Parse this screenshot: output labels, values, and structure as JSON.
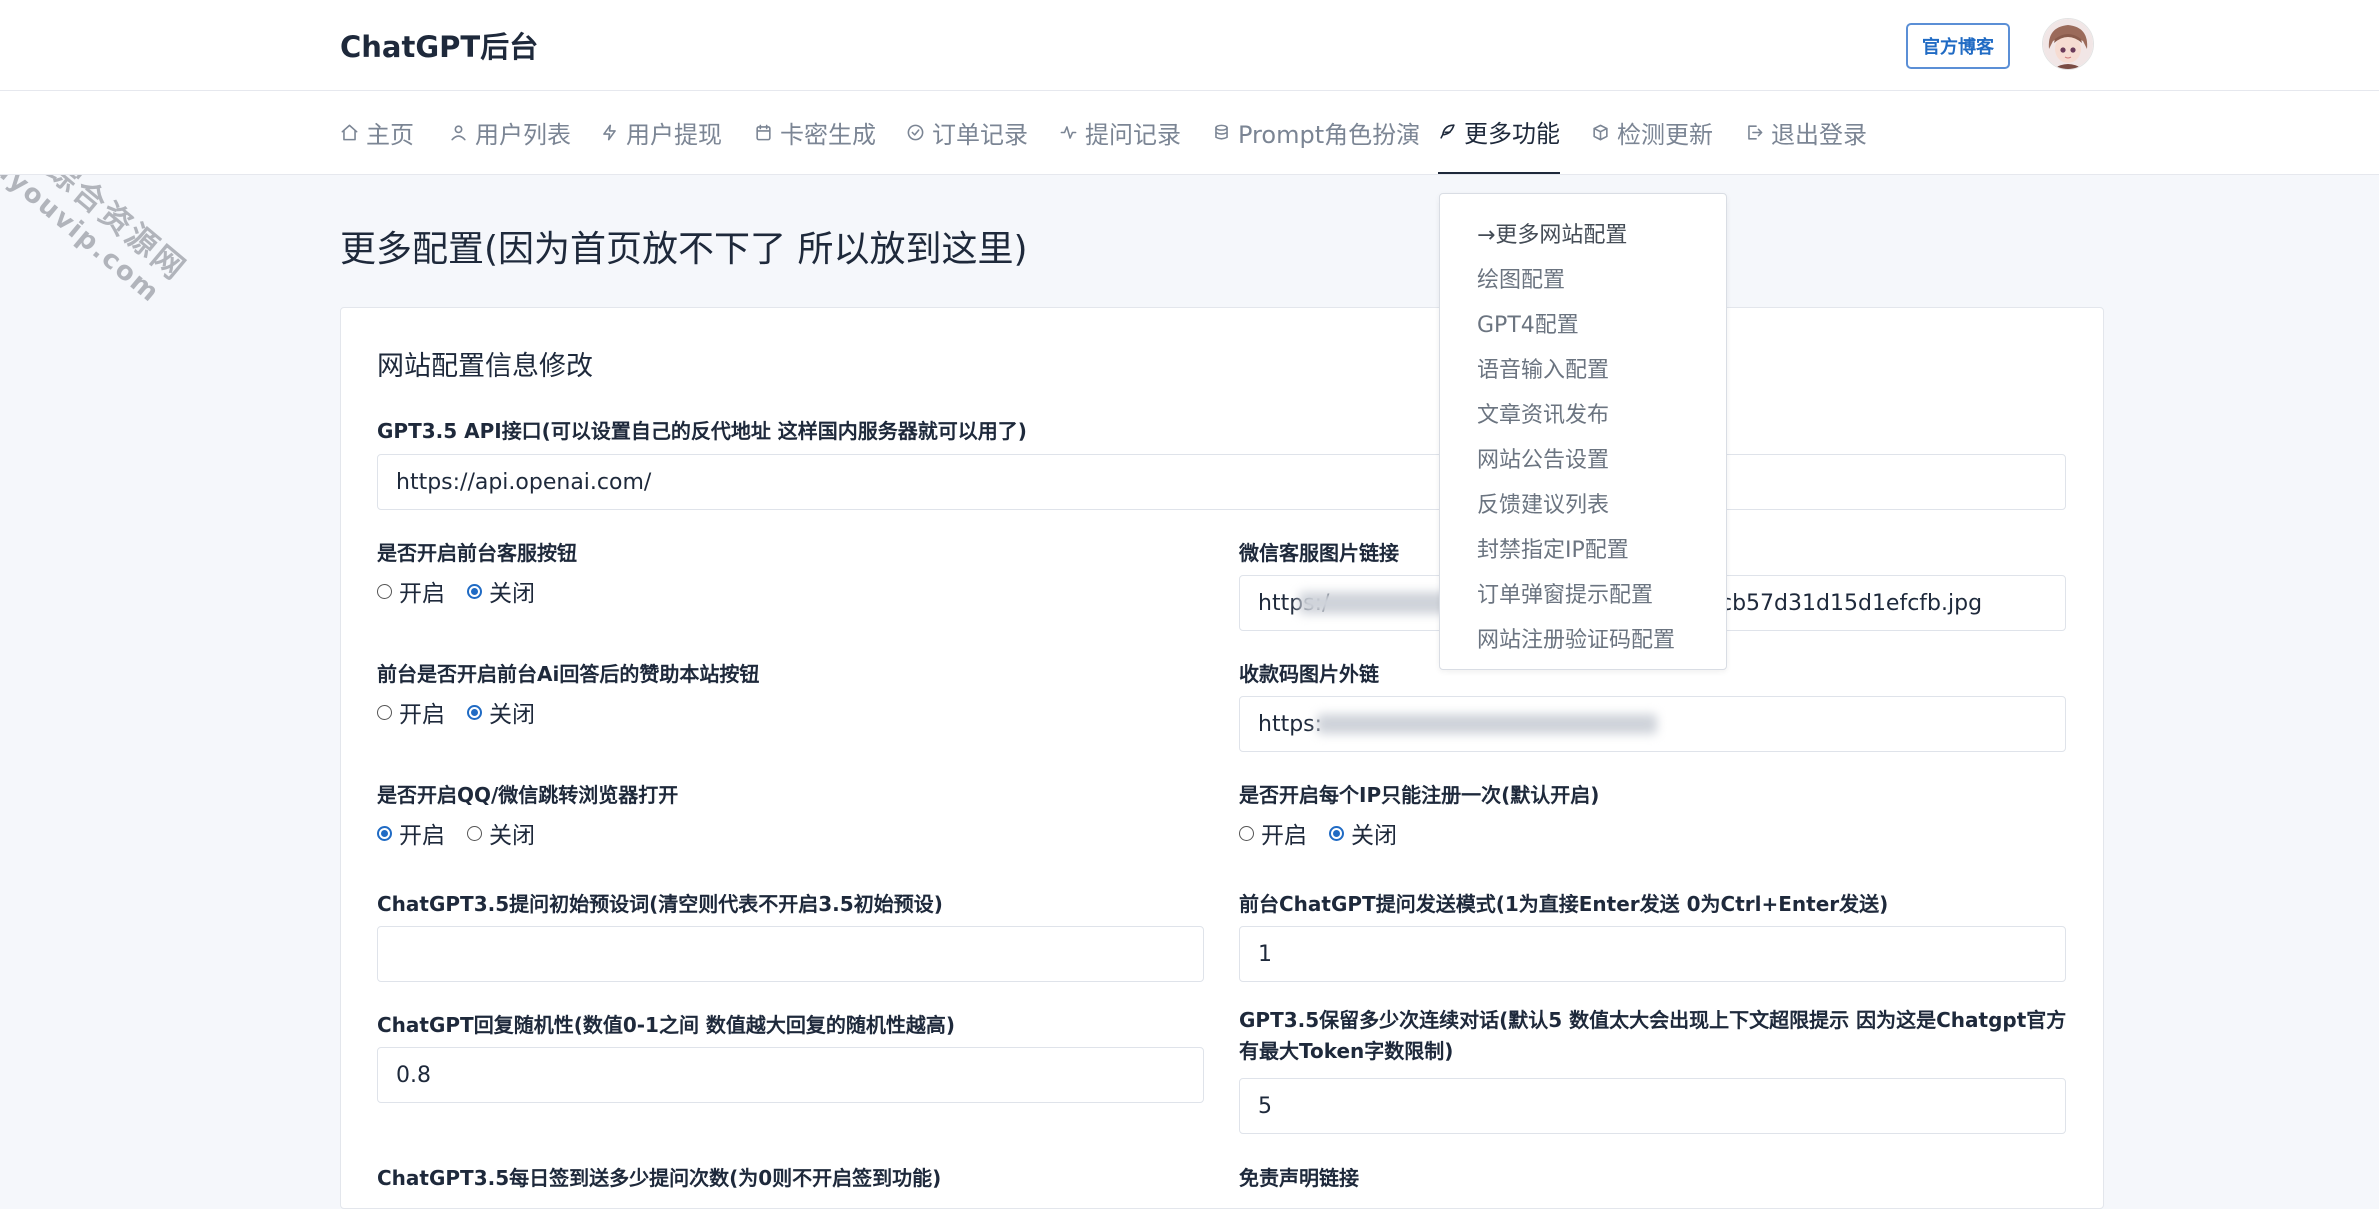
{
  "app": {
    "brand": "ChatGPT后台"
  },
  "header": {
    "blog_button": "官方博客"
  },
  "nav": {
    "items": [
      {
        "label": "主页",
        "icon": "home-icon"
      },
      {
        "label": "用户列表",
        "icon": "user-icon"
      },
      {
        "label": "用户提现",
        "icon": "bolt-icon"
      },
      {
        "label": "卡密生成",
        "icon": "calendar-icon"
      },
      {
        "label": "订单记录",
        "icon": "check-circle-icon"
      },
      {
        "label": "提问记录",
        "icon": "activity-icon"
      },
      {
        "label": "Prompt角色扮演",
        "icon": "database-icon"
      },
      {
        "label": "更多功能",
        "icon": "feather-icon",
        "active": true
      },
      {
        "label": "检测更新",
        "icon": "box-icon"
      },
      {
        "label": "退出登录",
        "icon": "logout-icon"
      }
    ]
  },
  "dropdown": {
    "items": [
      "→更多网站配置",
      "绘图配置",
      "GPT4配置",
      "语音输入配置",
      "文章资讯发布",
      "网站公告设置",
      "反馈建议列表",
      "封禁指定IP配置",
      "订单弹窗提示配置",
      "网站注册验证码配置"
    ]
  },
  "page": {
    "title": "更多配置(因为首页放不下了 所以放到这里)"
  },
  "card": {
    "title": "网站配置信息修改",
    "api": {
      "label": "GPT3.5 API接口(可以设置自己的反代地址 这样国内服务器就可以用了)",
      "value": "https://api.openai.com/"
    },
    "service_btn": {
      "label": "是否开启前台客服按钮",
      "options": [
        "开启",
        "关闭"
      ],
      "selected": "关闭"
    },
    "wechat_img": {
      "label": "微信客服图片链接",
      "prefix": "https:/",
      "suffix": "cb57d31d15d1efcfb.jpg"
    },
    "praise_btn": {
      "label": "前台是否开启前台Ai回答后的赞助本站按钮",
      "options": [
        "开启",
        "关闭"
      ],
      "selected": "关闭"
    },
    "pay_img": {
      "label": "收款码图片外链",
      "prefix": "https:"
    },
    "qq_redirect": {
      "label": "是否开启QQ/微信跳转浏览器打开",
      "options": [
        "开启",
        "关闭"
      ],
      "selected": "开启"
    },
    "ip_once": {
      "label": "是否开启每个IP只能注册一次(默认开启)",
      "options": [
        "开启",
        "关闭"
      ],
      "selected": "关闭"
    },
    "preset": {
      "label": "ChatGPT3.5提问初始预设词(清空则代表不开启3.5初始预设)",
      "value": ""
    },
    "send_mode": {
      "label": "前台ChatGPT提问发送模式(1为直接Enter发送 0为Ctrl+Enter发送)",
      "value": "1"
    },
    "temperature": {
      "label": "ChatGPT回复随机性(数值0-1之间 数值越大回复的随机性越高)",
      "value": "0.8"
    },
    "context": {
      "label": "GPT3.5保留多少次连续对话(默认5 数值太大会出现上下文超限提示 因为这是Chatgpt官方有最大Token字数限制)",
      "value": "5"
    },
    "signin": {
      "label": "ChatGPT3.5每日签到送多少提问次数(为0则不开启签到功能)"
    },
    "disclaimer": {
      "label": "免责声明链接"
    }
  },
  "watermark": {
    "line1": "全都有综合资源网",
    "line2": "douyouvip.com"
  }
}
